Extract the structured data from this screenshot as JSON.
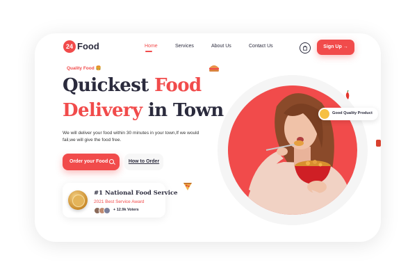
{
  "brand": {
    "badge": "24",
    "name": "Food"
  },
  "nav": {
    "items": [
      {
        "label": "Home",
        "active": true
      },
      {
        "label": "Services",
        "active": false
      },
      {
        "label": "About Us",
        "active": false
      },
      {
        "label": "Contact Us",
        "active": false
      }
    ]
  },
  "header": {
    "cart_icon": "shopping-bag-icon",
    "signup_label": "Sign Up",
    "signup_arrow": "→"
  },
  "hero": {
    "tag": "Quality Food 🍔",
    "title_line1_dark": "Quickest ",
    "title_line1_red": "Food",
    "title_line2_red": "Delivery",
    "title_line2_dark": " in Town",
    "description": "We will deliver your food within 30 minutes in your town,If we would fail,we will give the food free.",
    "order_label": "Order your Food",
    "how_label": "How to Order"
  },
  "award": {
    "title": "#1 National Food Service",
    "subtitle": "2021 Best Service Award",
    "voters": "+ 12.9k Voters"
  },
  "badge": {
    "label": "Good Quality Product"
  },
  "colors": {
    "accent": "#f14b4b",
    "dark": "#2b2b3d"
  }
}
